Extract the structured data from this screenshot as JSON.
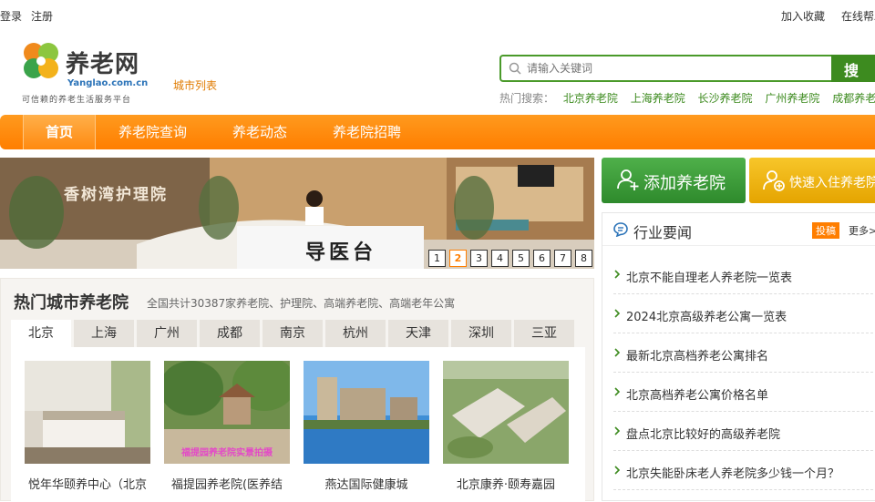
{
  "topbar": {
    "login": "登录",
    "register": "注册",
    "favorite": "加入收藏",
    "online_help": "在线帮助"
  },
  "logo": {
    "title": "养老网",
    "url": "Yanglao.com.cn",
    "slogan": "可信赖的养老生活服务平台"
  },
  "city_list": "城市列表",
  "search": {
    "placeholder": "请输入关键词",
    "button": "搜 索"
  },
  "hot_search": {
    "label": "热门搜索：",
    "items": [
      "北京养老院",
      "上海养老院",
      "长沙养老院",
      "广州养老院",
      "成都养老院"
    ]
  },
  "nav": {
    "items": [
      "首页",
      "养老院查询",
      "养老动态",
      "养老院招聘"
    ],
    "active": 0
  },
  "banner": {
    "sign": "香树湾护理院",
    "desk": "导医台",
    "pages": [
      "1",
      "2",
      "3",
      "4",
      "5",
      "6",
      "7",
      "8"
    ],
    "active_page": 1
  },
  "hot_cities": {
    "title": "热门城市养老院",
    "subtitle": "全国共计30387家养老院、护理院、高端养老院、高端老年公寓",
    "tabs": [
      "北京",
      "上海",
      "广州",
      "成都",
      "南京",
      "杭州",
      "天津",
      "深圳",
      "三亚"
    ],
    "active_tab": 0,
    "cards": [
      {
        "name": "悦年华颐养中心（北京"
      },
      {
        "name": "福提园养老院(医养结",
        "overlay": "福提园养老院实景拍摄"
      },
      {
        "name": "燕达国际健康城"
      },
      {
        "name": "北京康养·颐寿嘉园"
      }
    ]
  },
  "actions": {
    "add": "添加养老院",
    "fast": "快速入住养老院"
  },
  "news": {
    "title": "行业要闻",
    "submit": "投稿",
    "more": "更多>",
    "items": [
      "北京不能自理老人养老院一览表",
      "2024北京高级养老公寓一览表",
      "最新北京高档养老公寓排名",
      "北京高档养老公寓价格名单",
      "盘点北京比较好的高级养老院",
      "北京失能卧床老人养老院多少钱一个月？"
    ]
  },
  "colors": {
    "accent": "#ff7e00",
    "green": "#3d8b1f"
  }
}
